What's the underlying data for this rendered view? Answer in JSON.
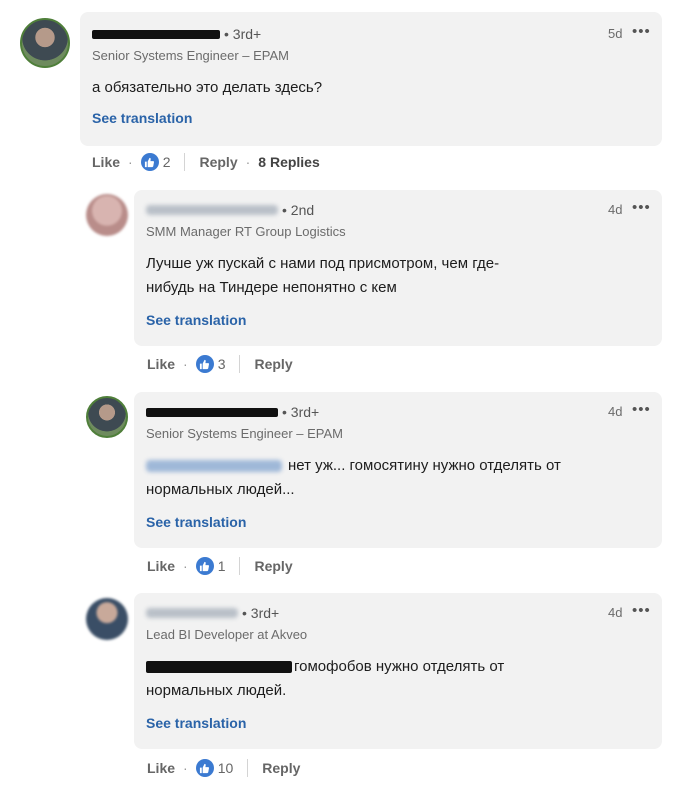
{
  "comments": [
    {
      "degree": "• 3rd+",
      "headline": "Senior Systems Engineer – EPAM",
      "time": "5d",
      "more": "•••",
      "text": "а обязательно это делать здесь?",
      "see_translation": "See translation",
      "like": "Like",
      "reactions": "2",
      "reply": "Reply",
      "replies": "8 Replies"
    },
    {
      "degree": "• 2nd",
      "headline": "SMM Manager RT Group Logistics",
      "time": "4d",
      "more": "•••",
      "text_line1": "Лучше уж пускай с нами под присмотром, чем где-",
      "text_line2": "нибудь на Тиндере непонятно с кем",
      "see_translation": "See translation",
      "like": "Like",
      "reactions": "3",
      "reply": "Reply"
    },
    {
      "degree": "• 3rd+",
      "headline": "Senior Systems Engineer – EPAM",
      "time": "4d",
      "more": "•••",
      "text_line1": "нет уж... гомосятину нужно отделять от",
      "text_line2": "нормальных людей...",
      "see_translation": "See translation",
      "like": "Like",
      "reactions": "1",
      "reply": "Reply"
    },
    {
      "degree": "• 3rd+",
      "headline": "Lead BI Developer at Akveo",
      "time": "4d",
      "more": "•••",
      "text_line1": "гомофобов нужно отделять от",
      "text_line2": "нормальных людей.",
      "see_translation": "See translation",
      "like": "Like",
      "reactions": "10",
      "reply": "Reply"
    }
  ],
  "colors": {
    "link": "#2a63a8",
    "like_badge": "#3b7ad1",
    "bubble": "#f2f2f2"
  },
  "icons": [
    "avatar",
    "redacted-name",
    "more-icon",
    "thumbs-up-icon"
  ]
}
